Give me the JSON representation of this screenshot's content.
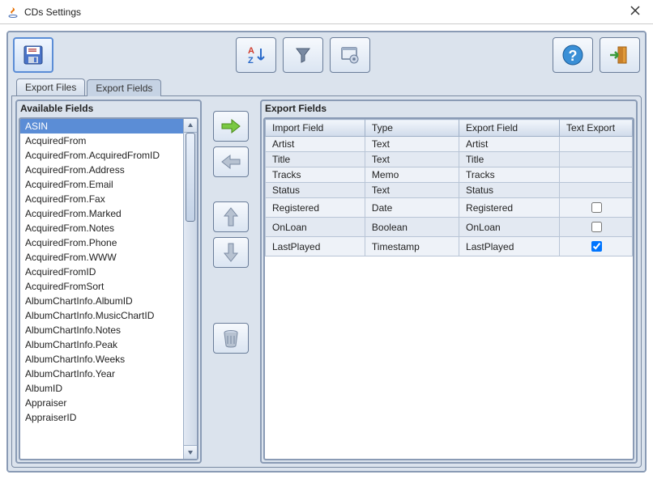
{
  "window": {
    "title": "CDs Settings"
  },
  "tabs": [
    {
      "label": "Export Files",
      "active": false
    },
    {
      "label": "Export Fields",
      "active": true
    }
  ],
  "left": {
    "legend": "Available Fields",
    "items": [
      "ASIN",
      "AcquiredFrom",
      "AcquiredFrom.AcquiredFromID",
      "AcquiredFrom.Address",
      "AcquiredFrom.Email",
      "AcquiredFrom.Fax",
      "AcquiredFrom.Marked",
      "AcquiredFrom.Notes",
      "AcquiredFrom.Phone",
      "AcquiredFrom.WWW",
      "AcquiredFromID",
      "AcquiredFromSort",
      "AlbumChartInfo.AlbumID",
      "AlbumChartInfo.MusicChartID",
      "AlbumChartInfo.Notes",
      "AlbumChartInfo.Peak",
      "AlbumChartInfo.Weeks",
      "AlbumChartInfo.Year",
      "AlbumID",
      "Appraiser",
      "AppraiserID"
    ],
    "selected_index": 0
  },
  "right": {
    "legend": "Export Fields",
    "headers": [
      "Import Field",
      "Type",
      "Export Field",
      "Text Export"
    ],
    "rows": [
      {
        "import": "Artist",
        "type": "Text",
        "export": "Artist",
        "text_export": null
      },
      {
        "import": "Title",
        "type": "Text",
        "export": "Title",
        "text_export": null
      },
      {
        "import": "Tracks",
        "type": "Memo",
        "export": "Tracks",
        "text_export": null
      },
      {
        "import": "Status",
        "type": "Text",
        "export": "Status",
        "text_export": null
      },
      {
        "import": "Registered",
        "type": "Date",
        "export": "Registered",
        "text_export": false
      },
      {
        "import": "OnLoan",
        "type": "Boolean",
        "export": "OnLoan",
        "text_export": false
      },
      {
        "import": "LastPlayed",
        "type": "Timestamp",
        "export": "LastPlayed",
        "text_export": true
      }
    ]
  }
}
